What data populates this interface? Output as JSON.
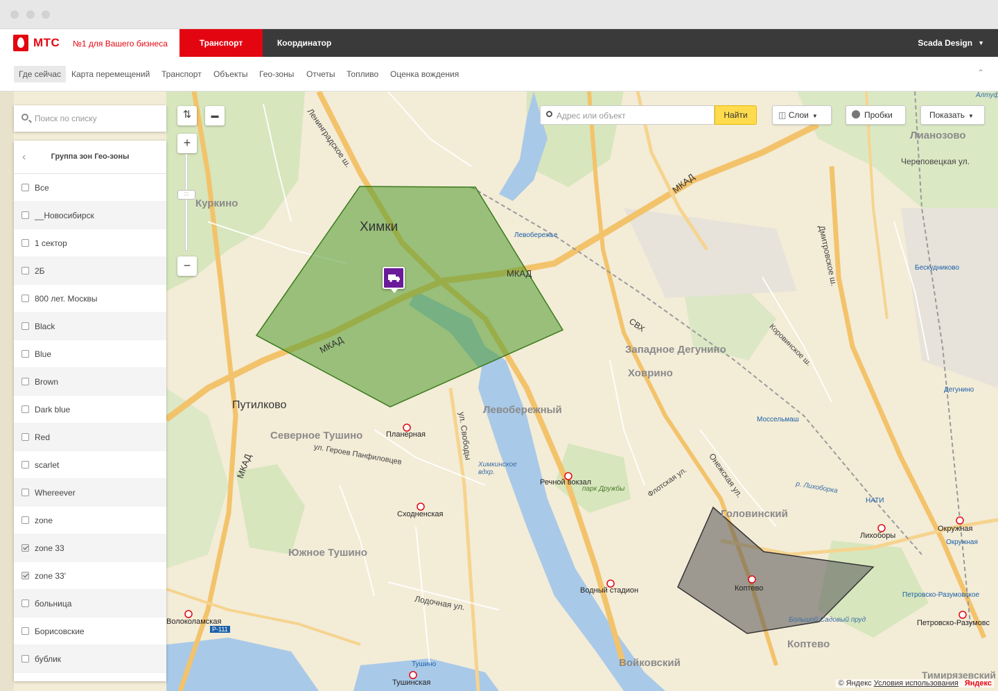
{
  "brand": {
    "logo": "МТС",
    "slogan": "№1 для Вашего бизнеса"
  },
  "top_tabs": [
    {
      "label": "Транспорт",
      "active": true
    },
    {
      "label": "Координатор",
      "active": false
    }
  ],
  "user": {
    "name": "Scada Design",
    "icon": "chevron-down-icon"
  },
  "subnav": [
    {
      "label": "Где сейчас",
      "active": true
    },
    {
      "label": "Карта перемещений"
    },
    {
      "label": "Транспорт"
    },
    {
      "label": "Объекты"
    },
    {
      "label": "Гео-зоны"
    },
    {
      "label": "Отчеты"
    },
    {
      "label": "Топливо"
    },
    {
      "label": "Оценка вождения"
    }
  ],
  "sidebar": {
    "search_placeholder": "Поиск по списку",
    "group_title": "Группа зон Гео-зоны",
    "items": [
      {
        "label": "Все",
        "checked": false
      },
      {
        "label": "__Новосибирск",
        "checked": false
      },
      {
        "label": "1 сектор",
        "checked": false
      },
      {
        "label": "2Б",
        "checked": false
      },
      {
        "label": "800 лет. Москвы",
        "checked": false
      },
      {
        "label": "Black",
        "checked": false
      },
      {
        "label": "Blue",
        "checked": false
      },
      {
        "label": "Brown",
        "checked": false
      },
      {
        "label": "Dark blue",
        "checked": false
      },
      {
        "label": "Red",
        "checked": false
      },
      {
        "label": "scarlet",
        "checked": false
      },
      {
        "label": "Whereever",
        "checked": false
      },
      {
        "label": "zone",
        "checked": false
      },
      {
        "label": "zone 33",
        "checked": true
      },
      {
        "label": "zone 33'",
        "checked": true
      },
      {
        "label": "больница",
        "checked": false
      },
      {
        "label": "Борисовские",
        "checked": false
      },
      {
        "label": "бублик",
        "checked": false
      }
    ]
  },
  "map_controls": {
    "address_placeholder": "Адрес или объект",
    "find_label": "Найти",
    "layers_label": "Слои",
    "traffic_label": "Пробки",
    "show_label": "Показать"
  },
  "map_labels": {
    "khimki": "Химки",
    "kurkino": "Куркино",
    "putilkovo": "Путилково",
    "sev_tushino": "Северное Тушино",
    "yuzh_tushino": "Южное Тушино",
    "levoberezhny": "Левобережный",
    "zap_degunino": "Западное Дегунино",
    "khovrino": "Ховрино",
    "golovinsky": "Головинский",
    "koptevo_district": "Коптево",
    "voykovsky": "Войковский",
    "lianozovo": "Лианозово",
    "mkad": "МКАД",
    "mkad2": "МКАД",
    "mkad3": "МКАД",
    "mkad4": "МКАД",
    "svh": "СВХ",
    "planernaya": "Планерная",
    "skhodnenskaya": "Сходненская",
    "rechnoy": "Речной вокзал",
    "vodny": "Водный стадион",
    "koptevo": "Коптево",
    "likhobory": "Лихоборы",
    "okruzhnaya": "Окружная",
    "tushinskaya": "Тушинская",
    "volokolamskaya": "Волоколамская",
    "petrovsko": "Петровско-Разумовс",
    "cherepovets": "Череповецкая ул.",
    "dmitrovskoe": "Дмитровское ш.",
    "leningradskoe": "Ленинградское ш.",
    "svobody": "ул. Свободы",
    "lodochnaya": "Лодочная ул.",
    "onezhskaya": "Онежская ул.",
    "flotskaya": "Флотская ул.",
    "levoberezhye": "Левобережье",
    "park_druzhby": "парк Дружбы",
    "khimki_vdhr": "Химкинское вдхр.",
    "bolshoy_sadovy": "Большой Садовый пруд",
    "altufyevo": "Алтуф",
    "geroev": "ул. Героев Панфиловцев",
    "korovinskoe": "Коровинское ш.",
    "tushino_st": "Тушино",
    "mosselmash": "Моссельмаш",
    "beskudnikovo": "Бескудниково",
    "degunino": "Дегунино",
    "nati": "НАТИ",
    "okruzhnaya_mcc": "Окружная",
    "petrovsko_mcc": "Петровско-Разумовское",
    "r111": "Р-111",
    "p_likhoborka": "р. Лихоборка",
    "timiryazevsky": "Тимирязевский"
  },
  "geozones": [
    {
      "name": "zone 33",
      "color": "#4f9a2e"
    },
    {
      "name": "zone 33'",
      "color": "#555555"
    }
  ],
  "vehicle": {
    "icon": "truck-icon",
    "color": "#6a1b9a"
  },
  "copyright": {
    "text": "© Яндекс",
    "terms": "Условия использования",
    "logo": "Яндекс"
  }
}
